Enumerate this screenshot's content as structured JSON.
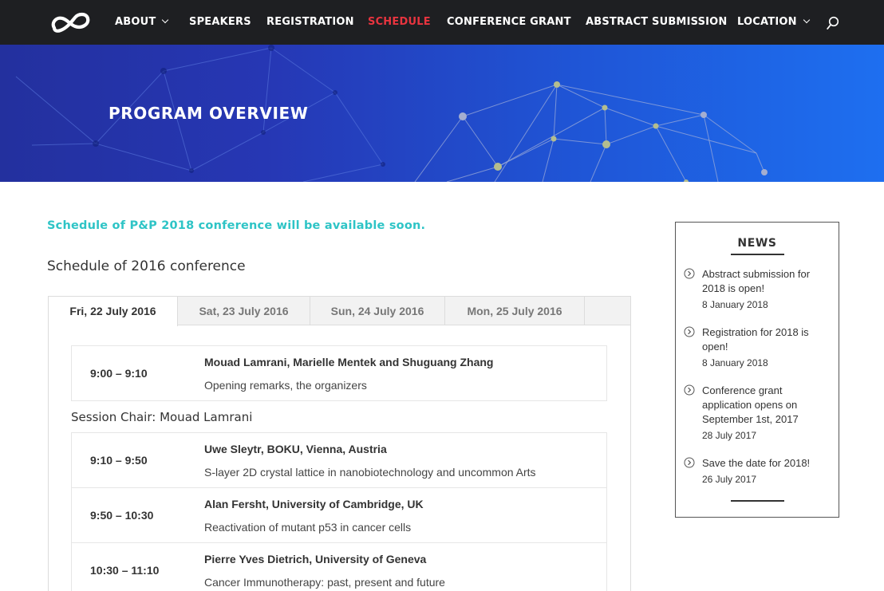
{
  "nav": {
    "items": [
      {
        "label": "ABOUT",
        "dropdown": true
      },
      {
        "label": "SPEAKERS",
        "dropdown": false
      },
      {
        "label": "REGISTRATION",
        "dropdown": false
      },
      {
        "label": "SCHEDULE",
        "dropdown": false,
        "active": true
      },
      {
        "label": "CONFERENCE GRANT",
        "dropdown": false
      },
      {
        "label": "ABSTRACT SUBMISSION",
        "dropdown": false
      },
      {
        "label": "LOCATION",
        "dropdown": true
      }
    ],
    "icons": {
      "logo": "infinity-logo-icon",
      "search": "search-icon",
      "dropdown": "chevron-down-icon"
    }
  },
  "hero": {
    "title": "PROGRAM OVERVIEW"
  },
  "main": {
    "announcement": "Schedule of P&P 2018 conference will be available soon.",
    "heading": "Schedule of 2016 conference",
    "tabs": [
      {
        "label": "Fri, 22 July 2016",
        "active": true
      },
      {
        "label": "Sat, 23 July 2016"
      },
      {
        "label": "Sun, 24 July 2016"
      },
      {
        "label": "Mon, 25 July 2016"
      }
    ],
    "opening": {
      "time": "9:00 – 9:10",
      "speaker": "Mouad Lamrani, Marielle Mentek and Shuguang Zhang",
      "talk": "Opening remarks, the organizers"
    },
    "session_chair": "Session Chair: Mouad Lamrani",
    "talks": [
      {
        "time": "9:10 – 9:50",
        "speaker": "Uwe Sleytr, BOKU, Vienna, Austria",
        "talk": "S-layer 2D crystal lattice in nanobiotechnology and uncommon Arts"
      },
      {
        "time": "9:50 – 10:30",
        "speaker": "Alan Fersht, University of Cambridge, UK",
        "talk": "Reactivation of mutant p53 in cancer cells"
      },
      {
        "time": "10:30 – 11:10",
        "speaker": "Pierre Yves Dietrich, University of Geneva",
        "talk": "Cancer Immunotherapy: past, present and future"
      }
    ]
  },
  "news": {
    "title": "NEWS",
    "icon": "circle-chevron-right-icon",
    "items": [
      {
        "headline": "Abstract submission for 2018 is open!",
        "date": "8 January 2018"
      },
      {
        "headline": "Registration for 2018 is open!",
        "date": "8 January 2018"
      },
      {
        "headline": "Conference grant application opens on September 1st, 2017",
        "date": "28 July 2017"
      },
      {
        "headline": "Save the date for 2018!",
        "date": "26 July 2017"
      }
    ]
  },
  "colors": {
    "nav_bg": "#1e1f22",
    "active_nav": "#e8343f",
    "announce": "#2ec4c6",
    "hero_start": "#23309e",
    "hero_end": "#1e6ff0"
  }
}
